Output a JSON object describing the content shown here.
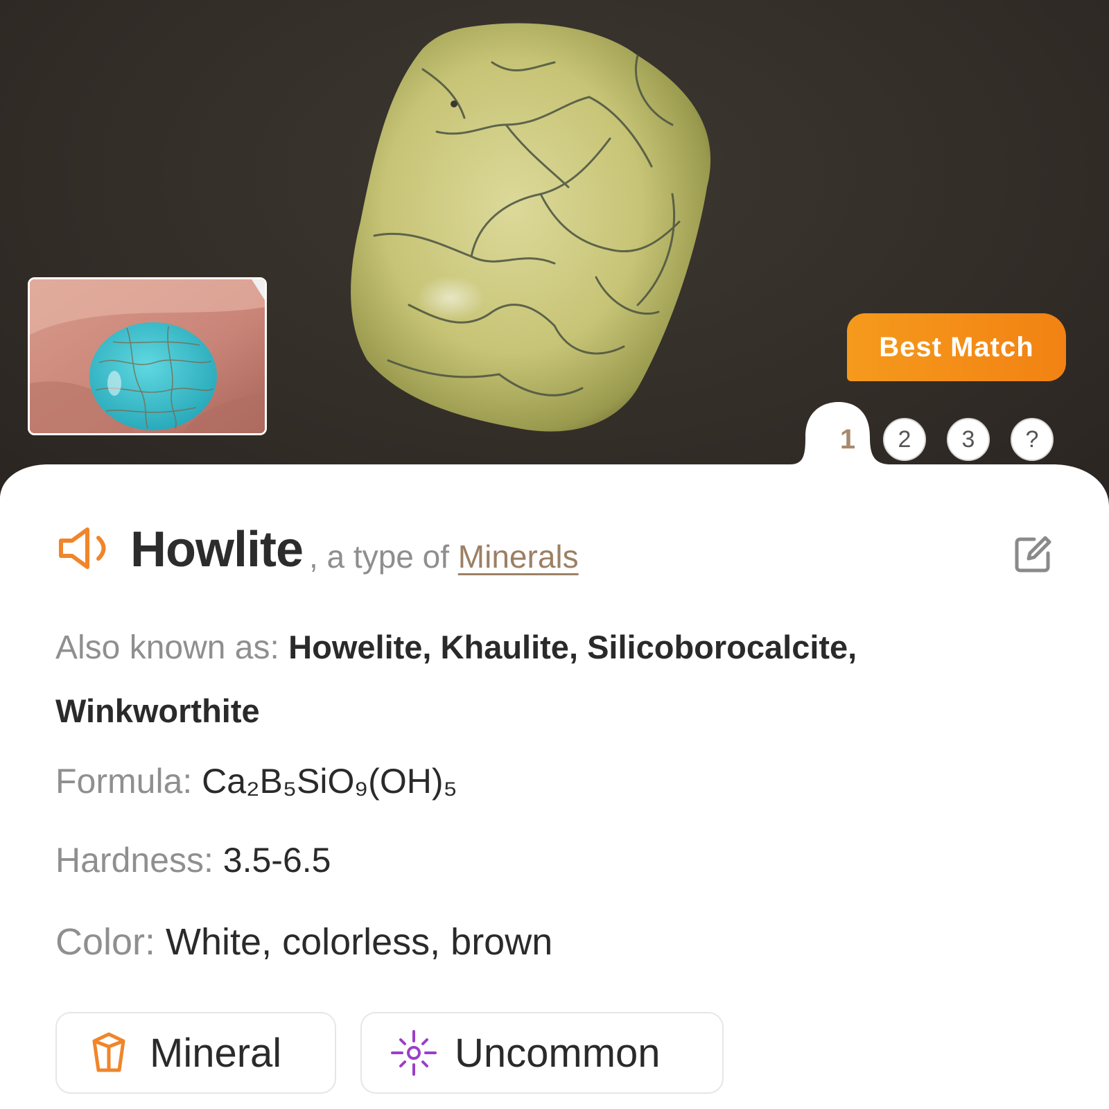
{
  "hero": {
    "best_match_label": "Best Match",
    "tabs": [
      "1",
      "2",
      "3",
      "?"
    ],
    "active_tab": "1"
  },
  "header": {
    "name": "Howlite",
    "type_prefix": ", a type of ",
    "type_link": "Minerals"
  },
  "details": {
    "aka_label": "Also known as: ",
    "aka_line1": "Howelite, Khaulite, Silicoborocalcite,",
    "aka_line2": "Winkworthite",
    "formula_label": "Formula: ",
    "formula_value": "Ca₂B₅SiO₉(OH)₅",
    "hardness_label": "Hardness: ",
    "hardness_value": "3.5-6.5",
    "color_label": "Color: ",
    "color_value": "White, colorless, brown"
  },
  "chips": [
    {
      "label": "Mineral",
      "icon": "crystal-icon",
      "color": "#f0852a"
    },
    {
      "label": "Uncommon",
      "icon": "sparkle-icon",
      "color": "#9b3fc8"
    }
  ],
  "colors": {
    "accent": "#f28c1e",
    "link": "#9c8064",
    "muted_label": "#8f8f8f"
  }
}
